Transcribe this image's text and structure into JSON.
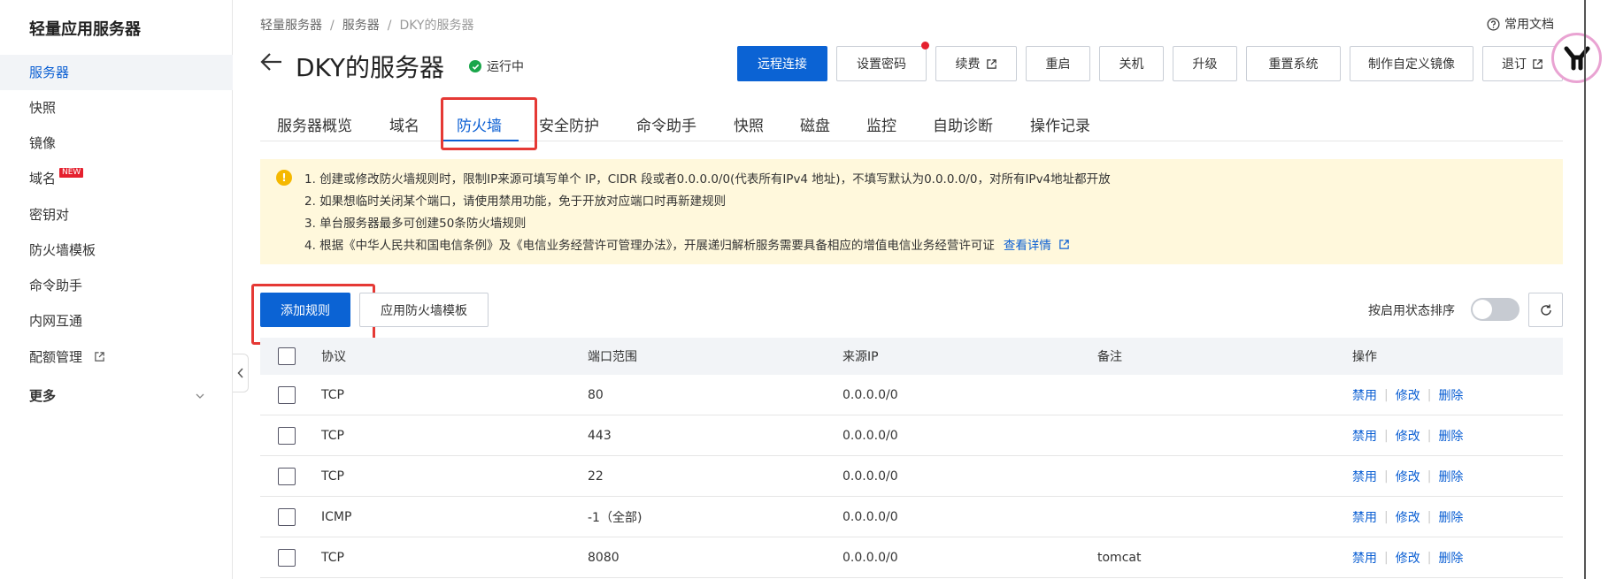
{
  "sidebar": {
    "title": "轻量应用服务器",
    "items": [
      {
        "label": "服务器",
        "active": true
      },
      {
        "label": "快照"
      },
      {
        "label": "镜像"
      },
      {
        "label": "域名",
        "badge": "NEW"
      },
      {
        "label": "密钥对"
      },
      {
        "label": "防火墙模板"
      },
      {
        "label": "命令助手"
      },
      {
        "label": "内网互通"
      },
      {
        "label": "配额管理"
      },
      {
        "label": "更多"
      }
    ]
  },
  "breadcrumb": [
    "轻量服务器",
    "服务器",
    "DKY的服务器"
  ],
  "breadcrumb_sep": "/",
  "help_label": "常用文档",
  "page_title": "DKY的服务器",
  "status_label": "运行中",
  "actions": {
    "remote": "远程连接",
    "password": "设置密码",
    "renew": "续费",
    "restart": "重启",
    "shutdown": "关机",
    "upgrade": "升级",
    "reinstall": "重置系统",
    "image": "制作自定义镜像",
    "refund": "退订"
  },
  "tabs": [
    "服务器概览",
    "域名",
    "防火墙",
    "安全防护",
    "命令助手",
    "快照",
    "磁盘",
    "监控",
    "自助诊断",
    "操作记录"
  ],
  "notice": {
    "icon": "!",
    "lines": [
      "1. 创建或修改防火墙规则时，限制IP来源可填写单个 IP，CIDR 段或者0.0.0.0/0(代表所有IPv4 地址)，不填写默认为0.0.0.0/0，对所有IPv4地址都开放",
      "2. 如果想临时关闭某个端口，请使用禁用功能，免于开放对应端口时再新建规则",
      "3. 单台服务器最多可创建50条防火墙规则",
      "4. 根据《中华人民共和国电信条例》及《电信业务经营许可管理办法》，开展递归解析服务需要具备相应的增值电信业务经营许可证"
    ],
    "link": "查看详情"
  },
  "toolbar": {
    "add_rule": "添加规则",
    "apply_template": "应用防火墙模板",
    "sort_label": "按启用状态排序"
  },
  "table": {
    "headers": [
      "协议",
      "端口范围",
      "来源IP",
      "备注",
      "操作"
    ],
    "ops": [
      "禁用",
      "修改",
      "删除"
    ],
    "rows": [
      {
        "protocol": "TCP",
        "port": "80",
        "source": "0.0.0.0/0",
        "note": ""
      },
      {
        "protocol": "TCP",
        "port": "443",
        "source": "0.0.0.0/0",
        "note": ""
      },
      {
        "protocol": "TCP",
        "port": "22",
        "source": "0.0.0.0/0",
        "note": ""
      },
      {
        "protocol": "ICMP",
        "port": "-1（全部)",
        "source": "0.0.0.0/0",
        "note": ""
      },
      {
        "protocol": "TCP",
        "port": "8080",
        "source": "0.0.0.0/0",
        "note": "tomcat"
      }
    ]
  },
  "colors": {
    "primary": "#0b63d4",
    "highlight": "#e53935",
    "notice_bg": "#fff8dc",
    "running": "#1aa64a"
  }
}
